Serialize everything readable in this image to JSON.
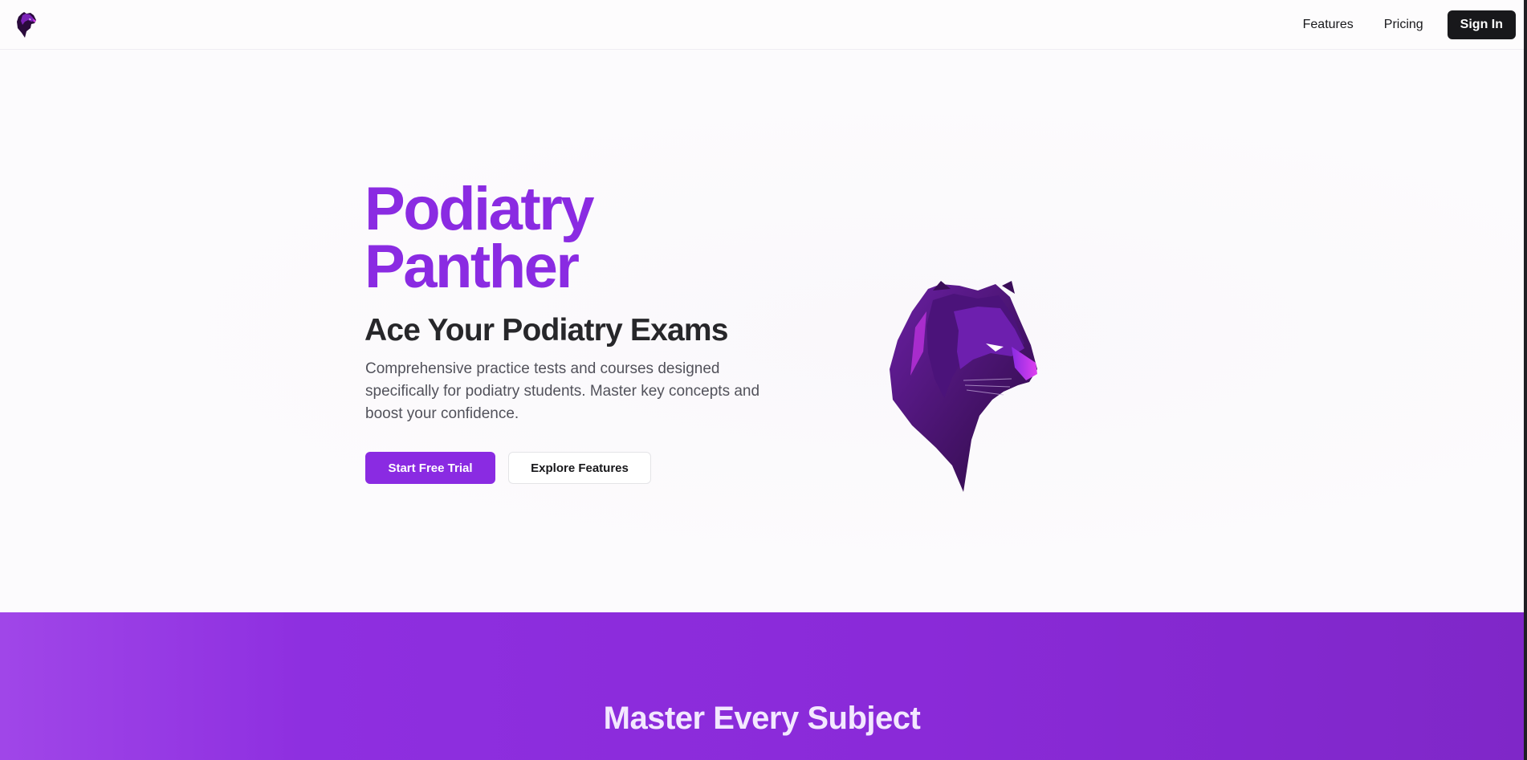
{
  "nav": {
    "logo_icon": "panther-head-icon",
    "links": [
      "Features",
      "Pricing"
    ],
    "signin_label": "Sign In"
  },
  "hero": {
    "title_line1": "Podiatry",
    "title_line2": "Panther",
    "subtitle": "Ace Your Podiatry Exams",
    "description": "Comprehensive practice tests and courses designed specifically for podiatry students. Master key concepts and boost your confidence.",
    "primary_cta": "Start Free Trial",
    "secondary_cta": "Explore Features",
    "illustration_icon": "panther-head-icon"
  },
  "section": {
    "title": "Master Every Subject"
  },
  "colors": {
    "brand": "#8a2be2",
    "dark": "#18181b",
    "band_start": "#a046e8",
    "band_end": "#7f27c8"
  }
}
